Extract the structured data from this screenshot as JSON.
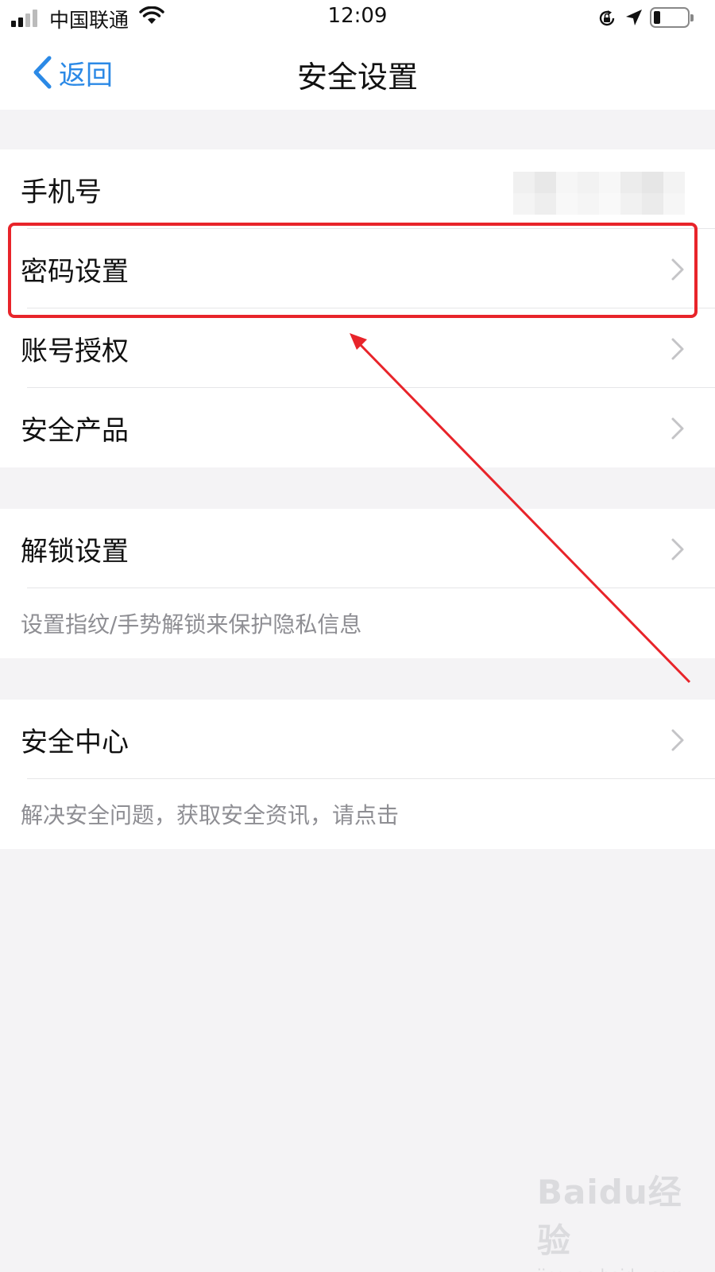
{
  "status_bar": {
    "carrier": "中国联通",
    "time": "12:09"
  },
  "nav": {
    "back_label": "返回",
    "title": "安全设置"
  },
  "account_group": {
    "phone_label": "手机号",
    "password_label": "密码设置",
    "auth_label": "账号授权",
    "products_label": "安全产品"
  },
  "unlock_group": {
    "label": "解锁设置",
    "hint": "设置指纹/手势解锁来保护隐私信息"
  },
  "center_group": {
    "label": "安全中心",
    "hint": "解决安全问题，获取安全资讯，请点击"
  },
  "watermark": {
    "logo": "Baidu经验",
    "url": "jingyan.baidu.com"
  },
  "colors": {
    "accent": "#2b89e6",
    "highlight": "#e8242a",
    "background": "#f4f3f5"
  }
}
